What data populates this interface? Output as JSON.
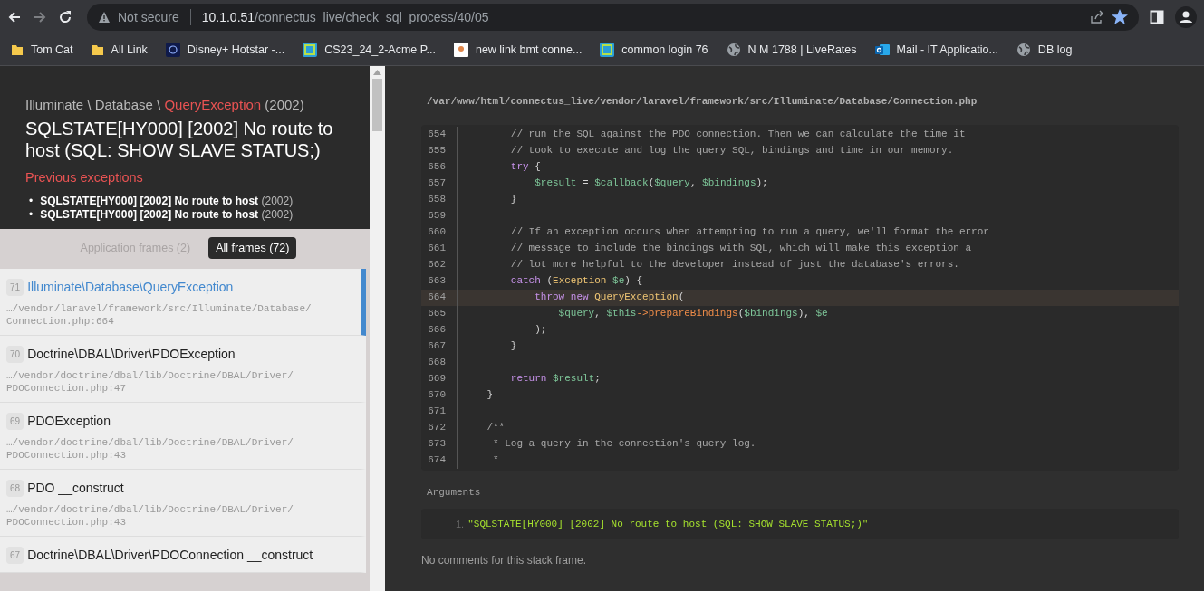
{
  "browser": {
    "security": "Not secure",
    "url_host": "10.1.0.51",
    "url_path": "/connectus_live/check_sql_process/40/05",
    "bookmarked": true,
    "bookmarks": [
      {
        "kind": "folder",
        "label": "Tom Cat"
      },
      {
        "kind": "folder",
        "label": "All Link"
      },
      {
        "kind": "tile",
        "label": "Disney+ Hotstar -..."
      },
      {
        "kind": "app",
        "label": "CS23_24_2-Acme P..."
      },
      {
        "kind": "page",
        "label": "new link bmt conne..."
      },
      {
        "kind": "app",
        "label": "common login 76"
      },
      {
        "kind": "globe",
        "label": "N M 1788 | LiveRates"
      },
      {
        "kind": "mail",
        "label": "Mail - IT Applicatio..."
      },
      {
        "kind": "globe",
        "label": "DB log"
      }
    ]
  },
  "exception": {
    "namespace": "Illuminate \\ Database \\ ",
    "class": "QueryException",
    "code": "(2002)",
    "message": "SQLSTATE[HY000] [2002] No route to host (SQL: SHOW SLAVE STATUS;)",
    "previous_title": "Previous exceptions",
    "previous": [
      {
        "bullet": "•",
        "message": "SQLSTATE[HY000] [2002] No route to host",
        "code": "(2002)"
      },
      {
        "bullet": "•",
        "message": "SQLSTATE[HY000] [2002] No route to host",
        "code": "(2002)"
      }
    ]
  },
  "frame_tabs": [
    {
      "label": "Application frames (2)",
      "selected": false
    },
    {
      "label": "All frames (72)",
      "selected": true
    }
  ],
  "frames": [
    {
      "number": "71",
      "title": "Illuminate\\Database\\QueryException",
      "path": "…/vendor/laravel/framework/src/Illuminate/Database/",
      "file": "Connection.php:664",
      "selected": true
    },
    {
      "number": "70",
      "title": "Doctrine\\DBAL\\Driver\\PDOException",
      "path": "…/vendor/doctrine/dbal/lib/Doctrine/DBAL/Driver/",
      "file": "PDOConnection.php:47",
      "selected": false
    },
    {
      "number": "69",
      "title": "PDOException",
      "path": "…/vendor/doctrine/dbal/lib/Doctrine/DBAL/Driver/",
      "file": "PDOConnection.php:43",
      "selected": false
    },
    {
      "number": "68",
      "title": "PDO __construct",
      "path": "…/vendor/doctrine/dbal/lib/Doctrine/DBAL/Driver/",
      "file": "PDOConnection.php:43",
      "selected": false
    },
    {
      "number": "67",
      "title": "Doctrine\\DBAL\\Driver\\PDOConnection __construct",
      "selected": false
    }
  ],
  "code_view": {
    "file_path": "/var/www/html/connectus_live/vendor/laravel/framework/src/Illuminate/Database/Connection.php",
    "lines": [
      {
        "number": "654",
        "selected": false,
        "tokens": [
          {
            "kind": "comment",
            "text": "        // run the SQL against the PDO connection. Then we can calculate the time it"
          }
        ]
      },
      {
        "number": "655",
        "selected": false,
        "tokens": [
          {
            "kind": "comment",
            "text": "        // took to execute and log the query SQL, bindings and time in our memory."
          }
        ]
      },
      {
        "number": "656",
        "selected": false,
        "tokens": [
          {
            "kind": "keyword",
            "text": "        try"
          },
          {
            "kind": "plain",
            "text": " {"
          }
        ]
      },
      {
        "number": "657",
        "selected": false,
        "tokens": [
          {
            "kind": "variable",
            "text": "            $result"
          },
          {
            "kind": "plain",
            "text": " = "
          },
          {
            "kind": "variable",
            "text": "$callback"
          },
          {
            "kind": "plain",
            "text": "("
          },
          {
            "kind": "variable",
            "text": "$query"
          },
          {
            "kind": "plain",
            "text": ", "
          },
          {
            "kind": "variable",
            "text": "$bindings"
          },
          {
            "kind": "plain",
            "text": ");"
          }
        ]
      },
      {
        "number": "658",
        "selected": false,
        "tokens": [
          {
            "kind": "plain",
            "text": "        }"
          }
        ]
      },
      {
        "number": "659",
        "selected": false
      },
      {
        "number": "660",
        "selected": false,
        "tokens": [
          {
            "kind": "comment",
            "text": "        // If an exception occurs when attempting to run a query, we'll format the error"
          }
        ]
      },
      {
        "number": "661",
        "selected": false,
        "tokens": [
          {
            "kind": "comment",
            "text": "        // message to include the bindings with SQL, which will make this exception a"
          }
        ]
      },
      {
        "number": "662",
        "selected": false,
        "tokens": [
          {
            "kind": "comment",
            "text": "        // lot more helpful to the developer instead of just the database's errors."
          }
        ]
      },
      {
        "number": "663",
        "selected": false,
        "tokens": [
          {
            "kind": "keyword",
            "text": "        catch"
          },
          {
            "kind": "plain",
            "text": " ("
          },
          {
            "kind": "class",
            "text": "Exception"
          },
          {
            "kind": "variable",
            "text": " $e"
          },
          {
            "kind": "plain",
            "text": ") {"
          }
        ]
      },
      {
        "number": "664",
        "selected": true,
        "tokens": [
          {
            "kind": "keyword",
            "text": "            throw new"
          },
          {
            "kind": "class",
            "text": " QueryException"
          },
          {
            "kind": "plain",
            "text": "("
          }
        ]
      },
      {
        "number": "665",
        "selected": false,
        "tokens": [
          {
            "kind": "variable",
            "text": "                $query"
          },
          {
            "kind": "plain",
            "text": ", "
          },
          {
            "kind": "variable",
            "text": "$this"
          },
          {
            "kind": "method",
            "text": "->prepareBindings"
          },
          {
            "kind": "plain",
            "text": "("
          },
          {
            "kind": "variable",
            "text": "$bindings"
          },
          {
            "kind": "plain",
            "text": "), "
          },
          {
            "kind": "variable",
            "text": "$e"
          }
        ]
      },
      {
        "number": "666",
        "selected": false,
        "tokens": [
          {
            "kind": "plain",
            "text": "            );"
          }
        ]
      },
      {
        "number": "667",
        "selected": false,
        "tokens": [
          {
            "kind": "plain",
            "text": "        }"
          }
        ]
      },
      {
        "number": "668",
        "selected": false
      },
      {
        "number": "669",
        "selected": false,
        "tokens": [
          {
            "kind": "keyword",
            "text": "        return"
          },
          {
            "kind": "variable",
            "text": " $result"
          },
          {
            "kind": "plain",
            "text": ";"
          }
        ]
      },
      {
        "number": "670",
        "selected": false,
        "tokens": [
          {
            "kind": "plain",
            "text": "    }"
          }
        ]
      },
      {
        "number": "671",
        "selected": false
      },
      {
        "number": "672",
        "selected": false,
        "tokens": [
          {
            "kind": "comment",
            "text": "    /**"
          }
        ]
      },
      {
        "number": "673",
        "selected": false,
        "tokens": [
          {
            "kind": "comment",
            "text": "     * Log a query in the connection's query log."
          }
        ]
      },
      {
        "number": "674",
        "selected": false,
        "tokens": [
          {
            "kind": "comment",
            "text": "     *"
          }
        ]
      }
    ]
  },
  "arguments": {
    "title": "Arguments",
    "items": [
      {
        "number": "1.",
        "value": "\"SQLSTATE[HY000] [2002] No route to host (SQL: SHOW SLAVE STATUS;)\""
      }
    ]
  },
  "comments_note": "No comments for this stack frame."
}
